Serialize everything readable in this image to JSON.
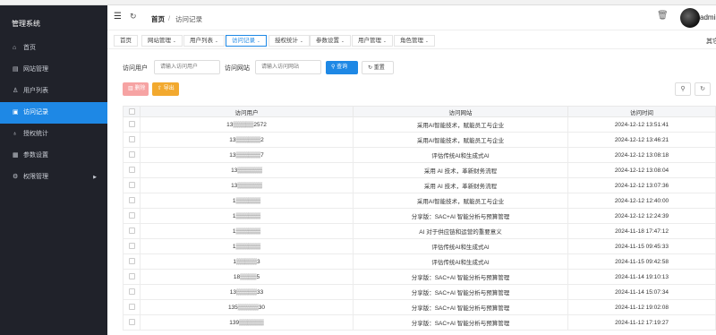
{
  "sidebar": {
    "title": "管理系统",
    "items": [
      {
        "label": "首页",
        "icon": "home-icon",
        "glyph": "⌂",
        "active": false,
        "arrow": ""
      },
      {
        "label": "网站管理",
        "icon": "website-icon",
        "glyph": "▤",
        "active": false,
        "arrow": ""
      },
      {
        "label": "用户列表",
        "icon": "user-icon",
        "glyph": "♙",
        "active": false,
        "arrow": ""
      },
      {
        "label": "访问记录",
        "icon": "record-icon",
        "glyph": "▣",
        "active": true,
        "arrow": ""
      },
      {
        "label": "授权统计",
        "icon": "bulb-icon",
        "glyph": "♁",
        "active": false,
        "arrow": ""
      },
      {
        "label": "参数设置",
        "icon": "grid-icon",
        "glyph": "▦",
        "active": false,
        "arrow": ""
      },
      {
        "label": "权限管理",
        "icon": "gear-icon",
        "glyph": "⚙",
        "active": false,
        "arrow": "▶"
      }
    ]
  },
  "header": {
    "breadcrumb_home": "首页",
    "breadcrumb_sep": "/",
    "breadcrumb_current": "访问记录",
    "username": "admin",
    "menu_glyph": "☰",
    "refresh_glyph": "↻",
    "trash_glyph": "🗑"
  },
  "tabs": {
    "items": [
      {
        "label": "首页",
        "dropdown": "",
        "active": false
      },
      {
        "label": "网站管理",
        "dropdown": "⌄",
        "active": false
      },
      {
        "label": "用户列表",
        "dropdown": "⌄",
        "active": false
      },
      {
        "label": "访问记录",
        "dropdown": "⌄",
        "active": true
      },
      {
        "label": "授权统计",
        "dropdown": "⌄",
        "active": false
      },
      {
        "label": "参数设置",
        "dropdown": "⌄",
        "active": false
      },
      {
        "label": "用户管理",
        "dropdown": "⌄",
        "active": false
      },
      {
        "label": "角色管理",
        "dropdown": "⌄",
        "active": false
      }
    ],
    "other_label": "其它"
  },
  "search": {
    "user_label": "访问用户",
    "user_placeholder": "请输入访问用户",
    "site_label": "访问网站",
    "site_placeholder": "请输入访问网站",
    "query_label": "查询",
    "query_glyph": "⚲",
    "reset_label": "重置",
    "reset_glyph": "↻"
  },
  "actions": {
    "delete_label": "删除",
    "delete_glyph": "▥",
    "export_label": "导出",
    "export_glyph": "⇧",
    "tool_search_glyph": "⚲",
    "tool_refresh_glyph": "↻"
  },
  "table": {
    "columns": [
      "访问用户",
      "访问网站",
      "访问时间"
    ],
    "rows": [
      {
        "user": "13▒▒▒▒▒2572",
        "site": "采用AI智能技术，赋能员工与企业",
        "time": "2024-12-12 13:51:41"
      },
      {
        "user": "13▒▒▒▒▒▒2",
        "site": "采用AI智能技术，赋能员工与企业",
        "time": "2024-12-12 13:46:21"
      },
      {
        "user": "13▒▒▒▒▒▒7",
        "site": "评估传统AI和生成式AI",
        "time": "2024-12-12 13:08:18"
      },
      {
        "user": "13▒▒▒▒▒▒",
        "site": "采用 AI 技术，革新财务流程",
        "time": "2024-12-12 13:08:04"
      },
      {
        "user": "13▒▒▒▒▒▒",
        "site": "采用 AI 技术，革新财务流程",
        "time": "2024-12-12 13:07:36"
      },
      {
        "user": "1▒▒▒▒▒▒",
        "site": "采用AI智能技术，赋能员工与企业",
        "time": "2024-12-12 12:40:00"
      },
      {
        "user": "1▒▒▒▒▒▒",
        "site": "分享版：SAC+AI 智能分析与预算管理",
        "time": "2024-12-12 12:24:39"
      },
      {
        "user": "1▒▒▒▒▒▒",
        "site": "AI 对于供应链和运营的重要意义",
        "time": "2024-11-18 17:47:12"
      },
      {
        "user": "1▒▒▒▒▒▒",
        "site": "评估传统AI和生成式AI",
        "time": "2024-11-15 09:45:33"
      },
      {
        "user": "1▒▒▒▒▒3",
        "site": "评估传统AI和生成式AI",
        "time": "2024-11-15 09:42:58"
      },
      {
        "user": "18▒▒▒▒5",
        "site": "分享版：SAC+AI 智能分析与预算管理",
        "time": "2024-11-14 19:10:13"
      },
      {
        "user": "13▒▒▒▒▒33",
        "site": "分享版：SAC+AI 智能分析与预算管理",
        "time": "2024-11-14 15:07:34"
      },
      {
        "user": "135▒▒▒▒▒30",
        "site": "分享版：SAC+AI 智能分析与预算管理",
        "time": "2024-11-12 19:02:08"
      },
      {
        "user": "139▒▒▒▒▒▒",
        "site": "分享版：SAC+AI 智能分析与预算管理",
        "time": "2024-11-12 17:19:27"
      }
    ]
  }
}
